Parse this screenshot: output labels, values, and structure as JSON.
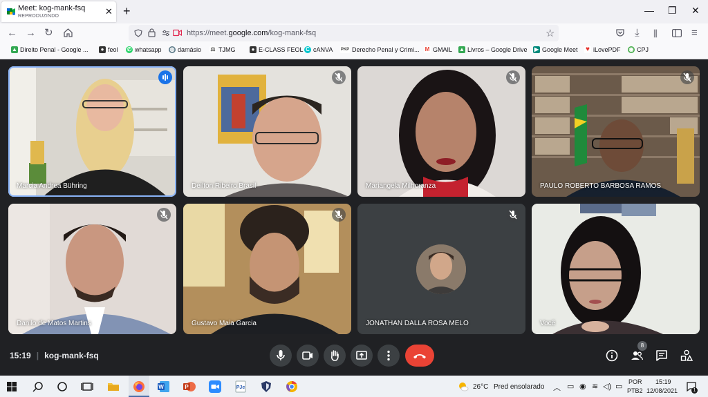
{
  "tab": {
    "title": "Meet: kog-mank-fsq",
    "subtitle": "REPRODUZINDO"
  },
  "url": {
    "prefix": "https://meet.",
    "domain": "google.com",
    "path": "/kog-mank-fsq"
  },
  "bookmarks": [
    {
      "label": "Direito Penal - Google ...",
      "icon": "google-drive-icon",
      "color": "#34a853"
    },
    {
      "label": "feol",
      "icon": "person-icon",
      "color": "#333333"
    },
    {
      "label": "whatsapp",
      "icon": "whatsapp-icon",
      "color": "#25d366"
    },
    {
      "label": "damásio",
      "icon": "globe-icon",
      "color": "#607d8b"
    },
    {
      "label": "TJMG",
      "icon": "scales-icon",
      "color": "#555555"
    },
    {
      "label": "E-CLASS FEOL",
      "icon": "person-icon",
      "color": "#333333"
    },
    {
      "label": "cANVA",
      "icon": "canva-icon",
      "color": "#00c4cc"
    },
    {
      "label": "Derecho Penal y Crimi...",
      "icon": "pkp-icon",
      "color": "#444444"
    },
    {
      "label": "GMAIL",
      "icon": "gmail-icon",
      "color": "#ea4335"
    },
    {
      "label": "Livros – Google Drive",
      "icon": "google-drive-icon",
      "color": "#34a853"
    },
    {
      "label": "Google Meet",
      "icon": "google-meet-icon",
      "color": "#00897b"
    },
    {
      "label": "iLovePDF",
      "icon": "heart-icon",
      "color": "#e5322d"
    },
    {
      "label": "CPJ",
      "icon": "cpj-icon",
      "color": "#4caf50"
    }
  ],
  "participants": [
    {
      "name": "Marcia Andrea Bühring",
      "status": "speaking"
    },
    {
      "name": "Deilton Ribeiro Brasil",
      "status": "muted"
    },
    {
      "name": "Mariangela Milhoranza",
      "status": "muted"
    },
    {
      "name": "PAULO ROBERTO BARBOSA RAMOS",
      "status": "muted"
    },
    {
      "name": "Danilo de Matos Martins",
      "status": "muted"
    },
    {
      "name": "Gustavo Maia Garcia",
      "status": "muted"
    },
    {
      "name": "JONATHAN DALLA ROSA MELO",
      "status": "muted"
    },
    {
      "name": "Você",
      "status": "self"
    }
  ],
  "meeting": {
    "time": "15:19",
    "code": "kog-mank-fsq",
    "participant_count": "8"
  },
  "taskbar": {
    "weather_temp": "26°C",
    "weather_text": "Pred ensolarado",
    "lang_top": "POR",
    "lang_bottom": "PTB2",
    "clock_time": "15:19",
    "clock_date": "12/08/2021",
    "notification_count": "1"
  },
  "colors": {
    "meet_bg": "#202124",
    "hangup": "#ea4335",
    "speaking": "#1a73e8",
    "active_outline": "#8ab4f8"
  }
}
